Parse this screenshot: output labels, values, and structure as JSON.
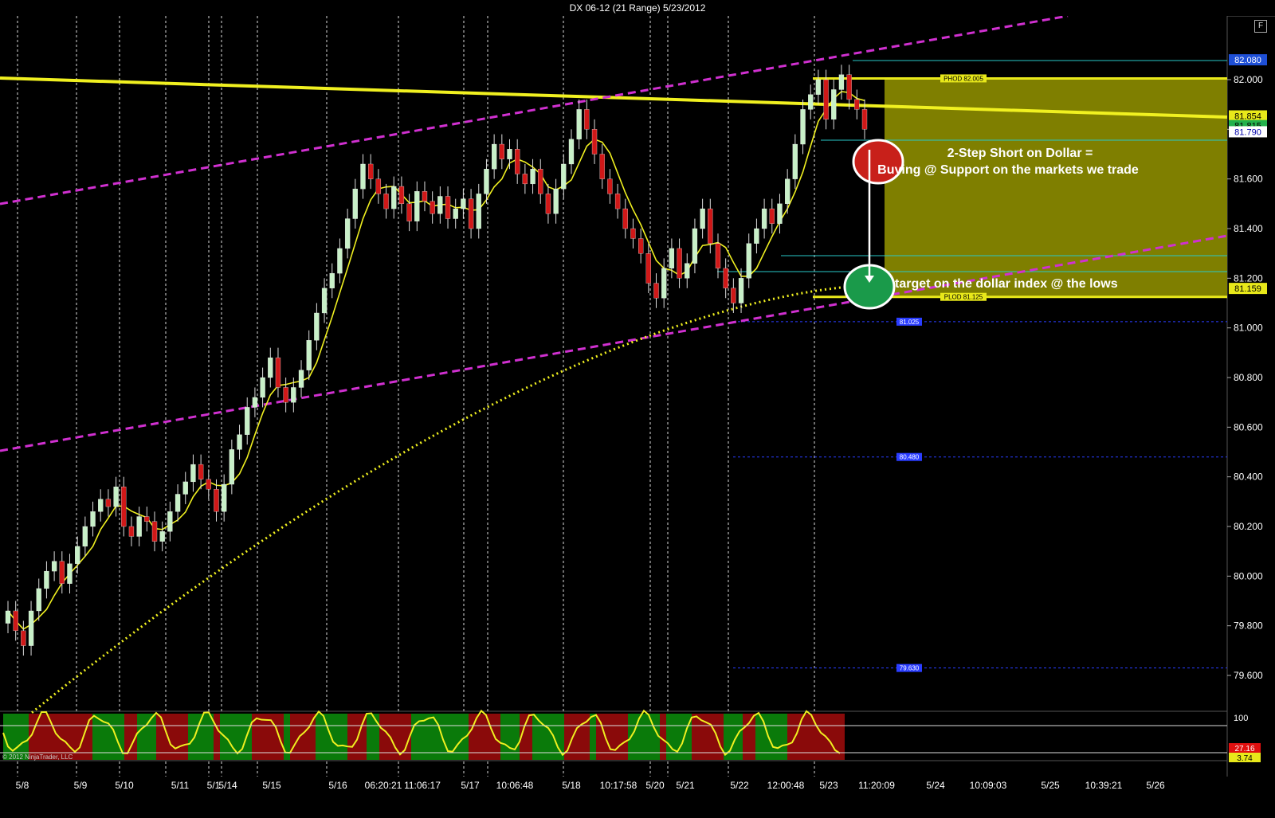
{
  "window": {
    "title": "DX 06-12 (21 Range)  5/23/2012",
    "float_button": "F"
  },
  "chart_data": {
    "type": "candlestick",
    "title": "DX 06-12 (21 Range)  5/23/2012",
    "ylim": [
      79.42,
      82.35
    ],
    "y_ticks": [
      "82.000",
      "81.800",
      "81.600",
      "81.400",
      "81.200",
      "81.000",
      "80.800",
      "80.600",
      "80.400",
      "80.200",
      "80.000",
      "79.800",
      "79.600"
    ],
    "x_labels": [
      "5/8",
      "5/9",
      "5/10",
      "5/11",
      "5/1",
      "5/14",
      "5/15",
      "5/16",
      "06:20:21",
      "11:06:17",
      "5/17",
      "10:06:48",
      "5/18",
      "10:17:58",
      "5/20",
      "5/21",
      "5/22",
      "12:00:48",
      "5/23",
      "11:20:09",
      "5/24",
      "10:09:03",
      "5/25",
      "10:39:21",
      "5/26"
    ],
    "price_tags": [
      {
        "value": "82.080",
        "color": "#1e4fd6",
        "text": "#ffffff"
      },
      {
        "value": "81.854",
        "color": "#e8e81a",
        "text": "#000000"
      },
      {
        "value": "81.815",
        "color": "#22b14c",
        "text": "#000000"
      },
      {
        "value": "81.790",
        "color": "#ffffff",
        "text": "#0000aa"
      },
      {
        "value": "81.159",
        "color": "#e8e81a",
        "text": "#000000"
      }
    ],
    "levels": [
      {
        "name": "PHOD",
        "label": "PHOD 82.005",
        "value": 82.005,
        "color": "#e8e81a"
      },
      {
        "name": "PLOD",
        "label": "PLOD 81.125",
        "value": 81.125,
        "color": "#e8e81a"
      },
      {
        "name": "s1",
        "label": "81.025",
        "value": 81.025,
        "color": "#2a3dff"
      },
      {
        "name": "s2",
        "label": "80.480",
        "value": 80.48,
        "color": "#2a3dff"
      },
      {
        "name": "s3",
        "label": "79.630",
        "value": 79.63,
        "color": "#2a3dff"
      }
    ],
    "close_series": [
      79.86,
      79.78,
      79.72,
      79.86,
      79.95,
      80.02,
      80.06,
      79.97,
      80.05,
      80.12,
      80.2,
      80.26,
      80.31,
      80.28,
      80.36,
      80.2,
      80.16,
      80.24,
      80.22,
      80.14,
      80.18,
      80.26,
      80.33,
      80.38,
      80.45,
      80.39,
      80.35,
      80.26,
      80.37,
      80.51,
      80.57,
      80.68,
      80.72,
      80.8,
      80.88,
      80.76,
      80.7,
      80.76,
      80.83,
      80.95,
      81.06,
      81.16,
      81.22,
      81.32,
      81.44,
      81.56,
      81.66,
      81.6,
      81.54,
      81.48,
      81.57,
      81.5,
      81.43,
      81.55,
      81.51,
      81.46,
      81.53,
      81.44,
      81.48,
      81.52,
      81.4,
      81.54,
      81.64,
      81.74,
      81.68,
      81.72,
      81.62,
      81.58,
      81.64,
      81.54,
      81.46,
      81.56,
      81.66,
      81.76,
      81.88,
      81.8,
      81.7,
      81.6,
      81.54,
      81.48,
      81.4,
      81.36,
      81.3,
      81.18,
      81.12,
      81.24,
      81.32,
      81.2,
      81.26,
      81.4,
      81.48,
      81.34,
      81.24,
      81.16,
      81.1,
      81.2,
      81.34,
      81.4,
      81.48,
      81.42,
      81.5,
      81.6,
      81.74,
      81.88,
      81.94,
      82.0,
      81.84,
      81.96,
      82.02,
      81.92,
      81.88,
      81.8
    ],
    "annotations": {
      "box_text_1": "2-Step Short on Dollar =",
      "box_text_2": "Buying @ Support on the markets we trade",
      "box_text_3": "target on the dollar index @ the lows"
    },
    "oscillator": {
      "ticks": [
        "100"
      ],
      "tags": [
        {
          "value": "27.16",
          "color": "#e01010"
        },
        {
          "value": "3.74",
          "color": "#e8e81a"
        }
      ]
    },
    "copyright": "© 2012 NinjaTrader, LLC"
  }
}
